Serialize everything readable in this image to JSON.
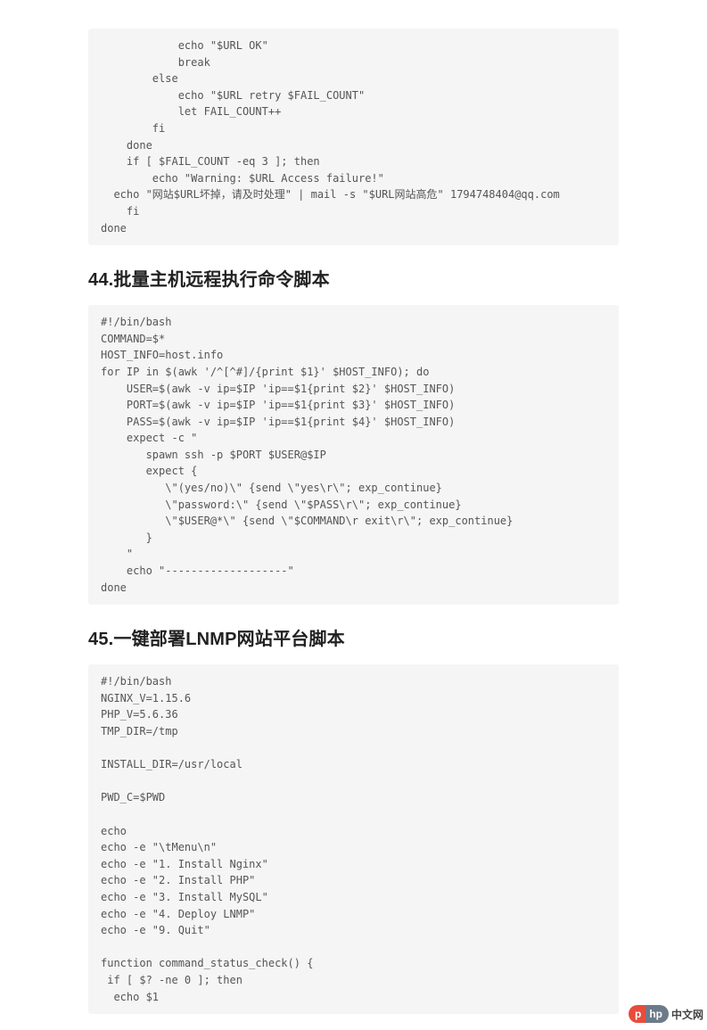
{
  "codeblock_1": "            echo \"$URL OK\"\n            break\n        else\n            echo \"$URL retry $FAIL_COUNT\"\n            let FAIL_COUNT++\n        fi\n    done\n    if [ $FAIL_COUNT -eq 3 ]; then\n        echo \"Warning: $URL Access failure!\"\n  echo \"网站$URL坏掉，请及时处理\" | mail -s \"$URL网站高危\" 1794748404@qq.com\n    fi\ndone",
  "heading_44": "44.批量主机远程执行命令脚本",
  "codeblock_2": "#!/bin/bash\nCOMMAND=$*\nHOST_INFO=host.info\nfor IP in $(awk '/^[^#]/{print $1}' $HOST_INFO); do\n    USER=$(awk -v ip=$IP 'ip==$1{print $2}' $HOST_INFO)\n    PORT=$(awk -v ip=$IP 'ip==$1{print $3}' $HOST_INFO)\n    PASS=$(awk -v ip=$IP 'ip==$1{print $4}' $HOST_INFO)\n    expect -c \"\n       spawn ssh -p $PORT $USER@$IP\n       expect {\n          \\\"(yes/no)\\\" {send \\\"yes\\r\\\"; exp_continue}\n          \\\"password:\\\" {send \\\"$PASS\\r\\\"; exp_continue}\n          \\\"$USER@*\\\" {send \\\"$COMMAND\\r exit\\r\\\"; exp_continue}\n       }\n    \"\n    echo \"-------------------\"\ndone",
  "heading_45": "45.一键部署LNMP网站平台脚本",
  "codeblock_3": "#!/bin/bash\nNGINX_V=1.15.6\nPHP_V=5.6.36\nTMP_DIR=/tmp\n\nINSTALL_DIR=/usr/local\n\nPWD_C=$PWD\n\necho\necho -e \"\\tMenu\\n\"\necho -e \"1. Install Nginx\"\necho -e \"2. Install PHP\"\necho -e \"3. Install MySQL\"\necho -e \"4. Deploy LNMP\"\necho -e \"9. Quit\"\n\nfunction command_status_check() {\n if [ $? -ne 0 ]; then\n  echo $1",
  "logo": {
    "p": "p",
    "hp": "hp",
    "text": "中文网"
  }
}
